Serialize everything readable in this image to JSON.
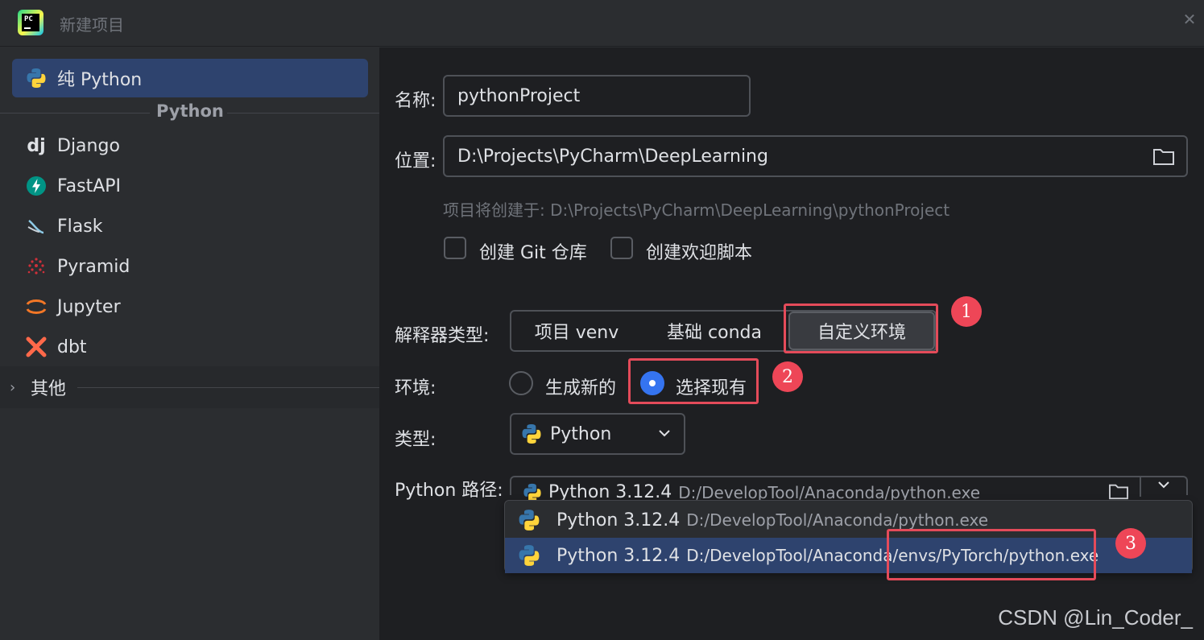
{
  "window": {
    "title": "新建项目"
  },
  "sidebar": {
    "selected": {
      "label": "纯 Python",
      "icon": "python-icon"
    },
    "group_label": "Python",
    "items": [
      {
        "label": "Django",
        "icon": "django-icon"
      },
      {
        "label": "FastAPI",
        "icon": "fastapi-icon"
      },
      {
        "label": "Flask",
        "icon": "flask-icon"
      },
      {
        "label": "Pyramid",
        "icon": "pyramid-icon"
      },
      {
        "label": "Jupyter",
        "icon": "jupyter-icon"
      },
      {
        "label": "dbt",
        "icon": "dbt-icon"
      }
    ],
    "other_label": "其他"
  },
  "form": {
    "name_label": "名称:",
    "name_value": "pythonProject",
    "location_label": "位置:",
    "location_value": "D:\\Projects\\PyCharm\\DeepLearning",
    "hint": "项目将创建于: D:\\Projects\\PyCharm\\DeepLearning\\pythonProject",
    "create_git_label": "创建 Git 仓库",
    "create_welcome_label": "创建欢迎脚本",
    "interpreter_type_label": "解释器类型:",
    "interpreter_types": [
      "项目 venv",
      "基础 conda",
      "自定义环境"
    ],
    "interpreter_type_selected": "自定义环境",
    "env_label": "环境:",
    "env_options": [
      "生成新的",
      "选择现有"
    ],
    "env_selected": "选择现有",
    "type_label": "类型:",
    "type_value": "Python",
    "python_path_label": "Python 路径:",
    "python_path_current": {
      "version": "Python 3.12.4",
      "path": "D:/DevelopTool/Anaconda/python.exe"
    }
  },
  "dropdown": {
    "options": [
      {
        "version": "Python 3.12.4",
        "path": "D:/DevelopTool/Anaconda/python.exe",
        "selected": false
      },
      {
        "version": "Python 3.12.4",
        "path_prefix": "D:/DevelopTool/Anaconda/",
        "path_highlight": "envs/PyTorch/python.exe",
        "selected": true
      }
    ]
  },
  "annotations": {
    "badge1": "1",
    "badge2": "2",
    "badge3": "3"
  },
  "watermark": "CSDN @Lin_Coder_",
  "colors": {
    "accent": "#3574f0",
    "selection": "#2e436e",
    "annotation_red": "#e44b5a"
  }
}
